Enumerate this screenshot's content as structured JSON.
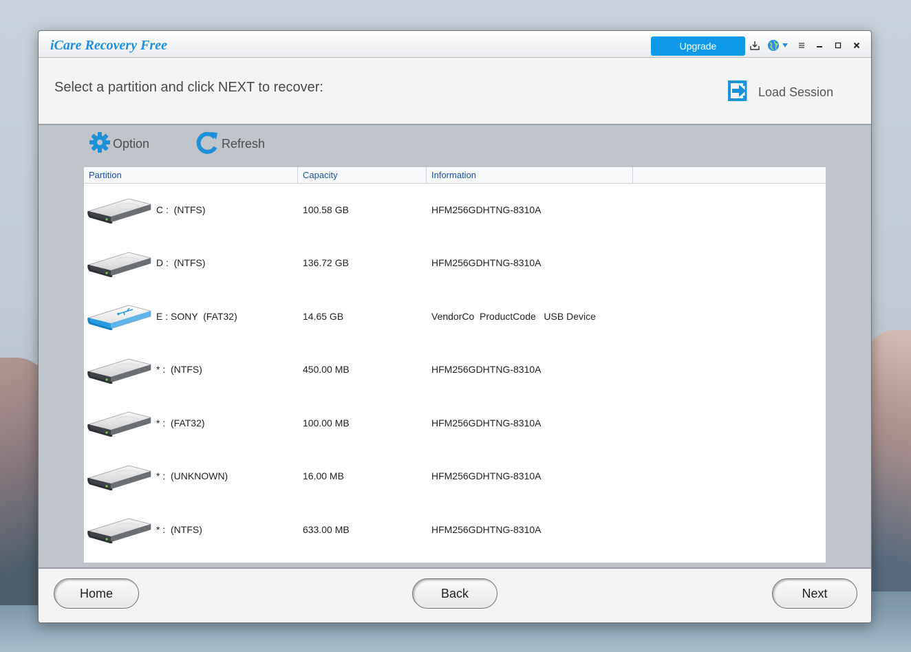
{
  "window": {
    "title": "iCare Recovery Free",
    "upgrade_label": "Upgrade"
  },
  "titlebar_icons": [
    "download-icon",
    "globe-icon",
    "dropdown-arrow-icon",
    "menu-icon",
    "minimize-icon",
    "maximize-icon",
    "close-icon"
  ],
  "header": {
    "instruction": "Select a partition and click NEXT to recover:",
    "load_session_label": "Load Session"
  },
  "toolbar": {
    "option_label": "Option",
    "refresh_label": "Refresh"
  },
  "table": {
    "columns": [
      "Partition",
      "Capacity",
      "Information"
    ],
    "rows": [
      {
        "partition": "C :  (NTFS)",
        "capacity": "100.58 GB",
        "information": "HFM256GDHTNG-8310A",
        "drive_type": "hdd"
      },
      {
        "partition": "D :  (NTFS)",
        "capacity": "136.72 GB",
        "information": "HFM256GDHTNG-8310A",
        "drive_type": "hdd"
      },
      {
        "partition": "E : SONY  (FAT32)",
        "capacity": "14.65 GB",
        "information": "VendorCo  ProductCode   USB Device",
        "drive_type": "usb"
      },
      {
        "partition": "* :  (NTFS)",
        "capacity": "450.00 MB",
        "information": "HFM256GDHTNG-8310A",
        "drive_type": "hdd"
      },
      {
        "partition": "* :  (FAT32)",
        "capacity": "100.00 MB",
        "information": "HFM256GDHTNG-8310A",
        "drive_type": "hdd"
      },
      {
        "partition": "* :  (UNKNOWN)",
        "capacity": "16.00 MB",
        "information": "HFM256GDHTNG-8310A",
        "drive_type": "hdd"
      },
      {
        "partition": "* :  (NTFS)",
        "capacity": "633.00 MB",
        "information": "HFM256GDHTNG-8310A",
        "drive_type": "hdd"
      }
    ]
  },
  "footer": {
    "home_label": "Home",
    "back_label": "Back",
    "next_label": "Next"
  },
  "colors": {
    "accent": "#0e9ae6",
    "title_blue": "#1e8fd8",
    "column_header_text": "#1a4fa0",
    "usb_drive_blue": "#2a9be0"
  }
}
